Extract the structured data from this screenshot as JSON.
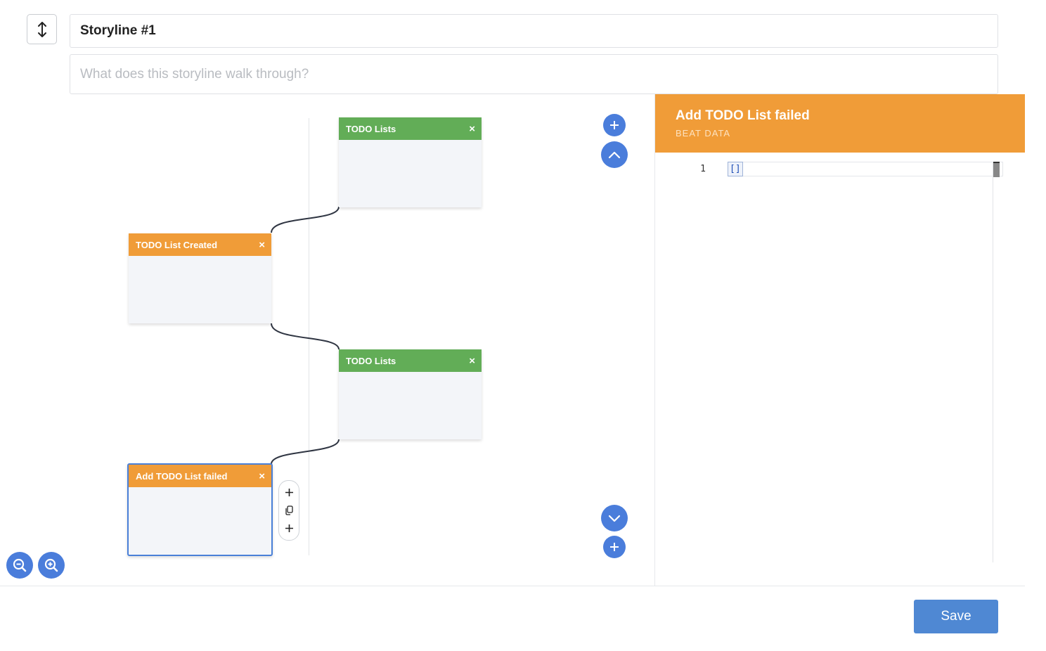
{
  "storyline": {
    "title": "Storyline #1",
    "description_placeholder": "What does this storyline walk through?"
  },
  "beats": [
    {
      "title": "TODO Lists",
      "color": "#62ad57"
    },
    {
      "title": "TODO List Created",
      "color": "#f09c38"
    },
    {
      "title": "TODO Lists",
      "color": "#62ad57"
    },
    {
      "title": "Add TODO List failed",
      "color": "#f09c38",
      "selected": true
    }
  ],
  "beat_close_glyph": "×",
  "panel": {
    "title": "Add TODO List failed",
    "subtitle": "BEAT DATA",
    "header_color": "#f09c38",
    "editor": {
      "line_number": "1",
      "code": "[]"
    }
  },
  "actions": {
    "save_label": "Save"
  },
  "icons": {
    "expand": "vertical-arrows-icon",
    "zoom_out": "zoom-out-icon",
    "zoom_in": "zoom-in-icon",
    "add": "plus-icon",
    "scroll_up": "chevron-up-icon",
    "scroll_down": "chevron-down-icon",
    "copy": "copy-icon"
  },
  "accent_color": "#4a7ddb"
}
